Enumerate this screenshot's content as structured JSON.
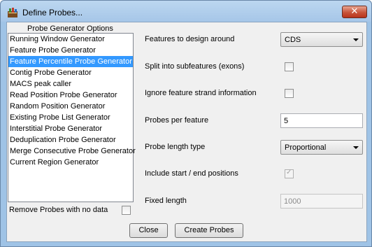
{
  "window": {
    "title": "Define Probes..."
  },
  "icons": {
    "app": "probe-app-icon",
    "close": "close-icon",
    "dropdown": "chevron-down-icon",
    "check": "checkmark-icon"
  },
  "colors": {
    "selection": "#3399ff",
    "titlebar": "#a6c6e8",
    "close": "#c8543a"
  },
  "options_panel": {
    "title": "Probe Generator Options",
    "items": [
      {
        "label": "Running Window Generator",
        "selected": false
      },
      {
        "label": "Feature Probe Generator",
        "selected": false
      },
      {
        "label": "Feature Percentile Probe Generator",
        "selected": true
      },
      {
        "label": "Contig Probe Generator",
        "selected": false
      },
      {
        "label": "MACS peak caller",
        "selected": false
      },
      {
        "label": "Read Position Probe Generator",
        "selected": false
      },
      {
        "label": "Random Position Generator",
        "selected": false
      },
      {
        "label": "Existing Probe List Generator",
        "selected": false
      },
      {
        "label": "Interstitial Probe Generator",
        "selected": false
      },
      {
        "label": "Deduplication Probe Generator",
        "selected": false
      },
      {
        "label": "Merge Consecutive Probe Generator",
        "selected": false
      },
      {
        "label": "Current Region Generator",
        "selected": false
      }
    ],
    "remove_label": "Remove Probes with no data",
    "remove_checked": false
  },
  "form": {
    "features_label": "Features to design around",
    "features_value": "CDS",
    "split_label": "Split into subfeatures (exons)",
    "split_checked": false,
    "ignore_strand_label": "Ignore feature strand information",
    "ignore_strand_checked": false,
    "probes_per_feature_label": "Probes per feature",
    "probes_per_feature_value": "5",
    "probe_length_type_label": "Probe length type",
    "probe_length_type_value": "Proportional",
    "include_start_end_label": "Include start / end positions",
    "include_start_end_checked": true,
    "include_start_end_disabled": true,
    "fixed_length_label": "Fixed length",
    "fixed_length_value": "1000",
    "fixed_length_disabled": true
  },
  "buttons": {
    "close": "Close",
    "create": "Create Probes"
  }
}
